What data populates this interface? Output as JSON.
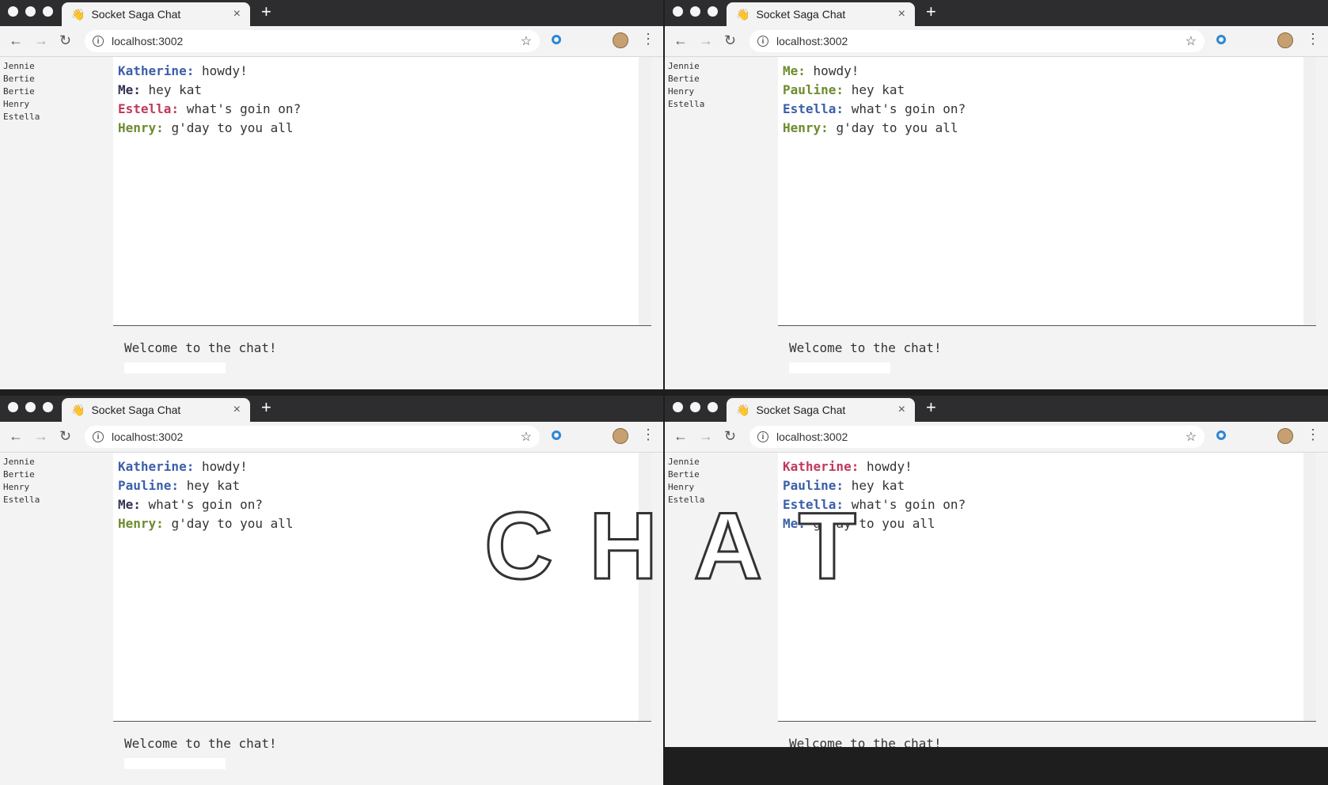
{
  "colors": {
    "katherine": "#3b5fa8",
    "pauline": "#3b5fa8",
    "estella": "#c0395a",
    "henry": "#6e8b2e",
    "me": "#333355",
    "katherine_alt": "#c0395a"
  },
  "windows": [
    {
      "tab_title": "Socket Saga Chat",
      "url": "localhost:3002",
      "users": [
        "Jennie",
        "Bertie",
        "Bertie",
        "Henry",
        "Estella"
      ],
      "messages": [
        {
          "author": "Katherine:",
          "text": "howdy!",
          "color": "#3b5fa8"
        },
        {
          "author": "Me:",
          "text": "hey kat",
          "color": "#333355"
        },
        {
          "author": "Estella:",
          "text": "what's goin on?",
          "color": "#c0395a"
        },
        {
          "author": "Henry:",
          "text": "g'day to you all",
          "color": "#6e8b2e"
        }
      ],
      "welcome": "Welcome to the chat!"
    },
    {
      "tab_title": "Socket Saga Chat",
      "url": "localhost:3002",
      "users": [
        "Jennie",
        "Bertie",
        "Henry",
        "Estella"
      ],
      "messages": [
        {
          "author": "Me:",
          "text": "howdy!",
          "color": "#6e8b2e"
        },
        {
          "author": "Pauline:",
          "text": "hey kat",
          "color": "#6e8b2e"
        },
        {
          "author": "Estella:",
          "text": "what's goin on?",
          "color": "#3b5fa8"
        },
        {
          "author": "Henry:",
          "text": "g'day to you all",
          "color": "#6e8b2e"
        }
      ],
      "welcome": "Welcome to the chat!"
    },
    {
      "tab_title": "Socket Saga Chat",
      "url": "localhost:3002",
      "users": [
        "Jennie",
        "Bertie",
        "Henry",
        "Estella"
      ],
      "messages": [
        {
          "author": "Katherine:",
          "text": "howdy!",
          "color": "#3b5fa8"
        },
        {
          "author": "Pauline:",
          "text": "hey kat",
          "color": "#3b5fa8"
        },
        {
          "author": "Me:",
          "text": "what's goin on?",
          "color": "#333355"
        },
        {
          "author": "Henry:",
          "text": "g'day to you all",
          "color": "#6e8b2e"
        }
      ],
      "welcome": "Welcome to the chat!"
    },
    {
      "tab_title": "Socket Saga Chat",
      "url": "localhost:3002",
      "users": [
        "Jennie",
        "Bertie",
        "Henry",
        "Estella"
      ],
      "messages": [
        {
          "author": "Katherine:",
          "text": "howdy!",
          "color": "#c0395a"
        },
        {
          "author": "Pauline:",
          "text": "hey kat",
          "color": "#3b5fa8"
        },
        {
          "author": "Estella:",
          "text": "what's goin on?",
          "color": "#3b5fa8"
        },
        {
          "author": "Me:",
          "text": "g'day to you all",
          "color": "#3b5fa8"
        }
      ],
      "welcome": "Welcome to the chat!"
    }
  ],
  "overlay_letters": [
    "C",
    "H",
    "A",
    "T"
  ],
  "icons": {
    "tab": "waving-hand-icon",
    "back": "back-arrow-icon",
    "forward": "forward-arrow-icon",
    "reload": "reload-icon",
    "info": "info-icon",
    "star": "star-icon",
    "menu": "menu-dots-icon"
  }
}
